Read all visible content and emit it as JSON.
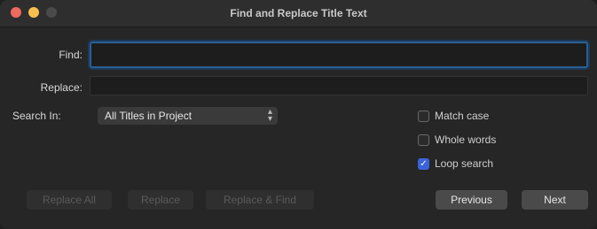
{
  "window": {
    "title": "Find and Replace Title Text"
  },
  "form": {
    "find_label": "Find:",
    "find_value": "",
    "replace_label": "Replace:",
    "replace_value": "",
    "search_in_label": "Search In:",
    "search_in_selected": "All Titles in Project"
  },
  "options": {
    "match_case": {
      "label": "Match case",
      "checked": false
    },
    "whole_words": {
      "label": "Whole words",
      "checked": false
    },
    "loop_search": {
      "label": "Loop search",
      "checked": true
    }
  },
  "buttons": {
    "replace_all": "Replace All",
    "replace": "Replace",
    "replace_and_find": "Replace & Find",
    "previous": "Previous",
    "next": "Next"
  },
  "icons": {
    "close": "close-icon",
    "minimize": "minimize-icon",
    "zoom": "zoom-icon",
    "select_chevron": "chevron-updown-icon",
    "checkmark": "checkmark-icon"
  },
  "colors": {
    "accent": "#3b63d9",
    "focus_ring": "#2a5f92",
    "background": "#262626"
  }
}
